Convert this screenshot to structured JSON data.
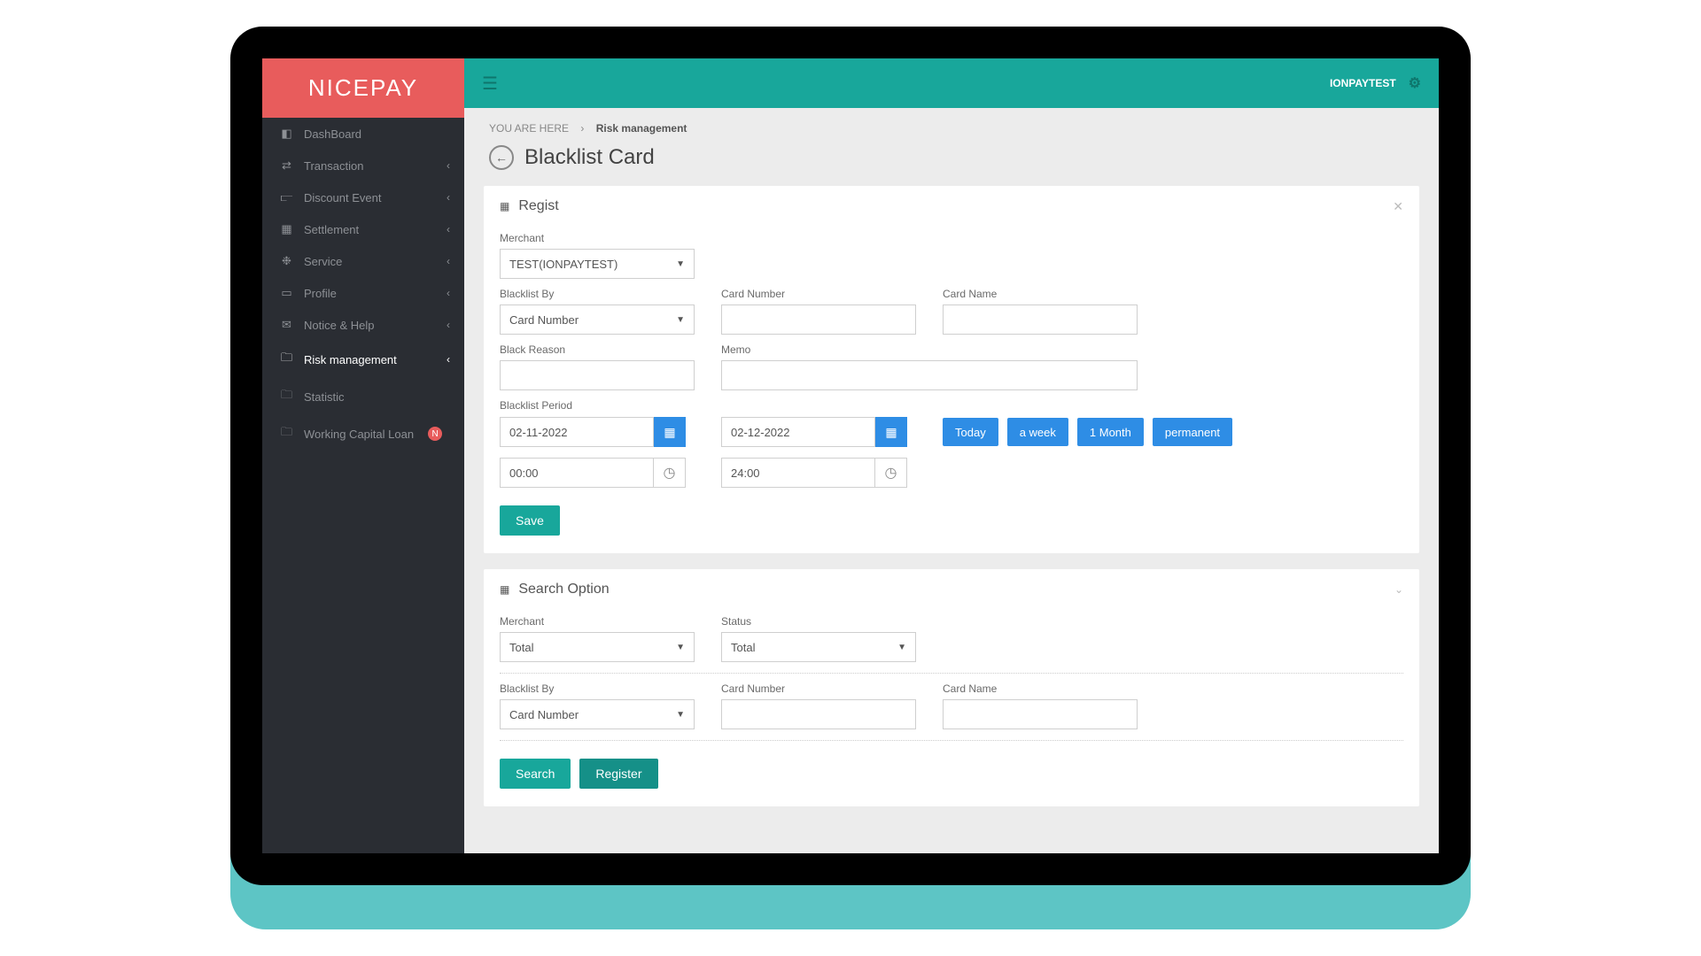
{
  "brand": "NICEPAY",
  "topbar": {
    "user": "IONPAYTEST"
  },
  "sidebar": {
    "items": [
      {
        "label": "DashBoard",
        "icon": "📊",
        "chev": false
      },
      {
        "label": "Transaction",
        "icon": "⇄",
        "chev": true
      },
      {
        "label": "Discount Event",
        "icon": "📈",
        "chev": true
      },
      {
        "label": "Settlement",
        "icon": "📅",
        "chev": true
      },
      {
        "label": "Service",
        "icon": "👥",
        "chev": true
      },
      {
        "label": "Profile",
        "icon": "🖥",
        "chev": true
      },
      {
        "label": "Notice & Help",
        "icon": "💬",
        "chev": true
      },
      {
        "label": "Risk management",
        "icon": "📁",
        "chev": true,
        "active": true
      },
      {
        "label": "Statistic",
        "icon": "📁",
        "chev": false
      },
      {
        "label": "Working Capital Loan",
        "icon": "📁",
        "chev": false,
        "badge": "N"
      }
    ]
  },
  "breadcrumb": {
    "prefix": "YOU ARE HERE",
    "sep": "›",
    "current": "Risk management"
  },
  "page": {
    "title": "Blacklist Card"
  },
  "regist": {
    "title": "Regist",
    "merchant_label": "Merchant",
    "merchant_value": "TEST(IONPAYTEST)",
    "blacklist_by_label": "Blacklist By",
    "blacklist_by_value": "Card Number",
    "card_number_label": "Card Number",
    "card_name_label": "Card Name",
    "black_reason_label": "Black Reason",
    "memo_label": "Memo",
    "period_label": "Blacklist Period",
    "start_date": "02-11-2022",
    "end_date": "02-12-2022",
    "start_time": "00:00",
    "end_time": "24:00",
    "quick": {
      "today": "Today",
      "week": "a week",
      "month": "1 Month",
      "perm": "permanent"
    },
    "save": "Save"
  },
  "search": {
    "title": "Search Option",
    "merchant_label": "Merchant",
    "merchant_value": "Total",
    "status_label": "Status",
    "status_value": "Total",
    "blacklist_by_label": "Blacklist By",
    "blacklist_by_value": "Card Number",
    "card_number_label": "Card Number",
    "card_name_label": "Card Name",
    "search_btn": "Search",
    "register_btn": "Register"
  }
}
